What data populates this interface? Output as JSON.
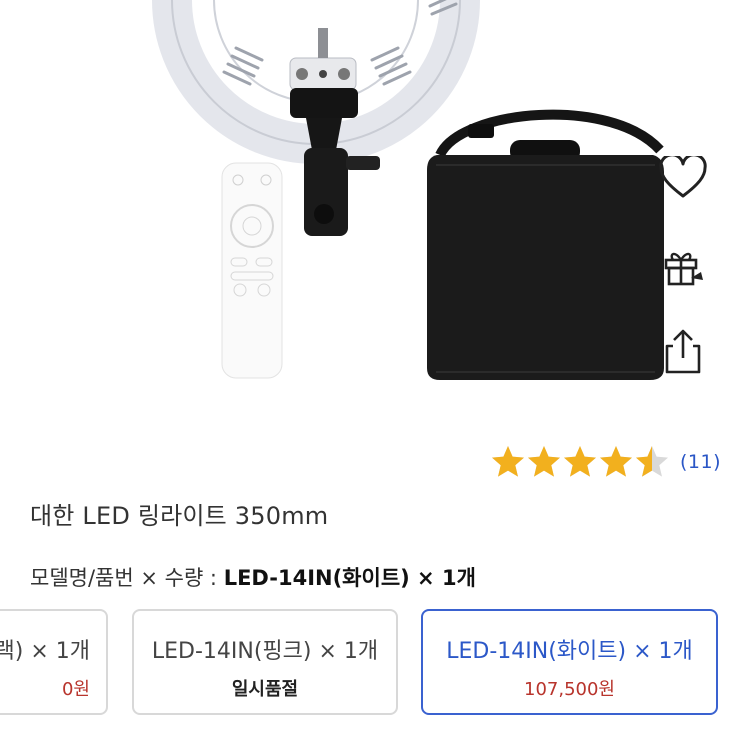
{
  "product": {
    "title": "대한 LED 링라이트 350mm",
    "rating": {
      "value": 4.5,
      "max": 5,
      "review_count": "(11)"
    }
  },
  "actions": [
    {
      "name": "wishlist-button",
      "icon": "heart-icon"
    },
    {
      "name": "gift-button",
      "icon": "gift-icon"
    },
    {
      "name": "share-button",
      "icon": "share-icon"
    }
  ],
  "option_summary": {
    "label": "모델명/품번 × 수량 :",
    "value": "LED-14IN(화이트) × 1개"
  },
  "options": [
    {
      "label": "랙) × 1개",
      "sub": "0원",
      "sub_type": "price",
      "selected": false
    },
    {
      "label": "LED-14IN(핑크) × 1개",
      "sub": "일시품절",
      "sub_type": "status",
      "selected": false
    },
    {
      "label": "LED-14IN(화이트) × 1개",
      "sub": "107,500원",
      "sub_type": "price",
      "selected": true
    }
  ],
  "colors": {
    "accent": "#2c58c8",
    "price": "#b8342c",
    "star": "#f2b01e",
    "star_empty": "#d9d9d9"
  }
}
